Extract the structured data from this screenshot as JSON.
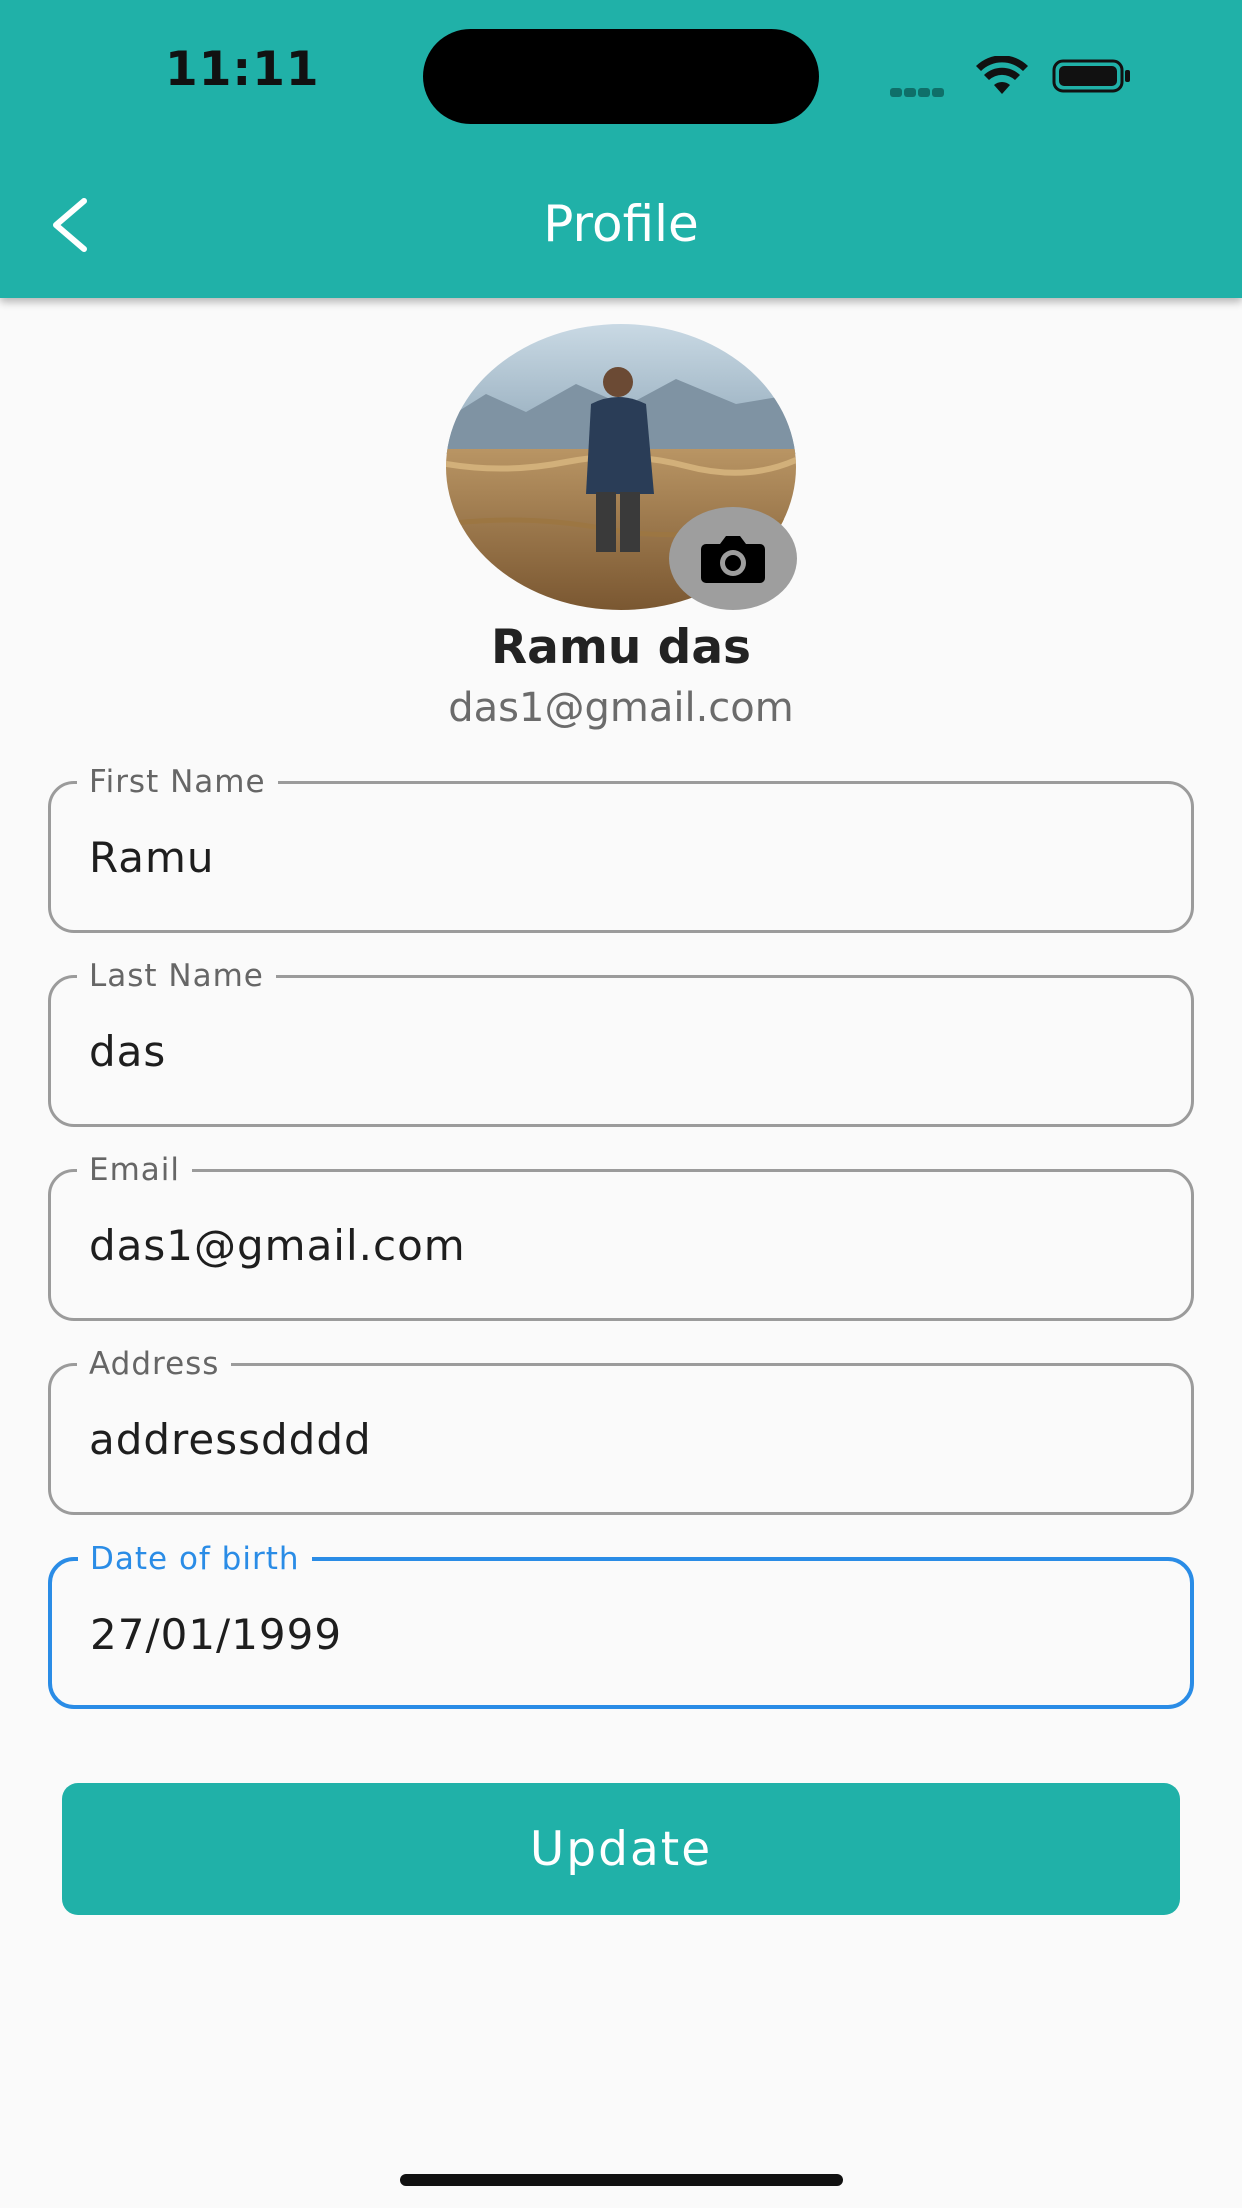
{
  "status_bar": {
    "time": "11:11"
  },
  "header": {
    "title": "Profile",
    "back_icon": "chevron-left-icon"
  },
  "profile": {
    "avatar_icon": "camera-icon",
    "name": "Ramu das",
    "email": "das1@gmail.com"
  },
  "form": {
    "fields": [
      {
        "label": "First Name",
        "value": "Ramu"
      },
      {
        "label": "Last Name",
        "value": "das"
      },
      {
        "label": "Email",
        "value": "das1@gmail.com"
      },
      {
        "label": "Address",
        "value": "addressdddd"
      },
      {
        "label": "Date of birth",
        "value": "27/01/1999"
      }
    ],
    "submit_label": "Update"
  },
  "colors": {
    "primary": "#20b1a8",
    "focus": "#2a8ce6",
    "background": "#fafafa",
    "border": "#9b9b9b"
  }
}
